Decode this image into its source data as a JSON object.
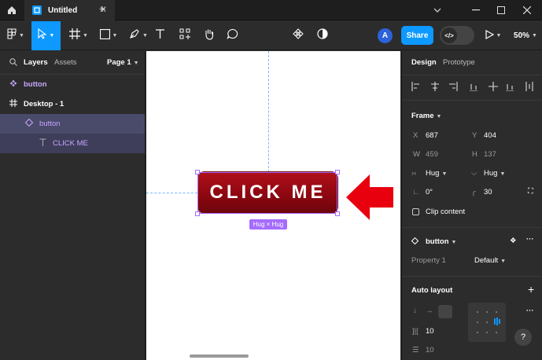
{
  "tabbar": {
    "tab_title": "Untitled",
    "close_glyph": "✕",
    "add_glyph": "+"
  },
  "toolbar": {
    "share_label": "Share",
    "avatar_initial": "A",
    "zoom": "50%",
    "devmode_glyph": "</>"
  },
  "left_panel": {
    "layers_tab": "Layers",
    "assets_tab": "Assets",
    "page_selector": "Page 1",
    "layers": [
      {
        "label": "button",
        "type": "component"
      },
      {
        "label": "Desktop - 1",
        "type": "frame"
      },
      {
        "label": "button",
        "type": "instance"
      },
      {
        "label": "CLICK ME",
        "type": "text"
      }
    ]
  },
  "canvas": {
    "button_text": "CLICK ME",
    "size_badge": "Hug × Hug",
    "arrow_color": "#e8000f"
  },
  "right_panel": {
    "design_tab": "Design",
    "prototype_tab": "Prototype",
    "frame_label": "Frame",
    "x_label": "X",
    "x_value": "687",
    "y_label": "Y",
    "y_value": "404",
    "w_label": "W",
    "w_value": "459",
    "h_label": "H",
    "h_value": "137",
    "hug_w": "Hug",
    "hug_h": "Hug",
    "rotation": "0°",
    "radius": "30",
    "clip_content": "Clip content",
    "component_name": "button",
    "property_label": "Property 1",
    "property_value": "Default",
    "auto_layout_label": "Auto layout",
    "gap_value": "10",
    "padding_value": "10",
    "help": "?"
  },
  "colors": {
    "accent": "#0d99ff",
    "selection": "#a56cff",
    "button_red": "#9b0a12"
  }
}
